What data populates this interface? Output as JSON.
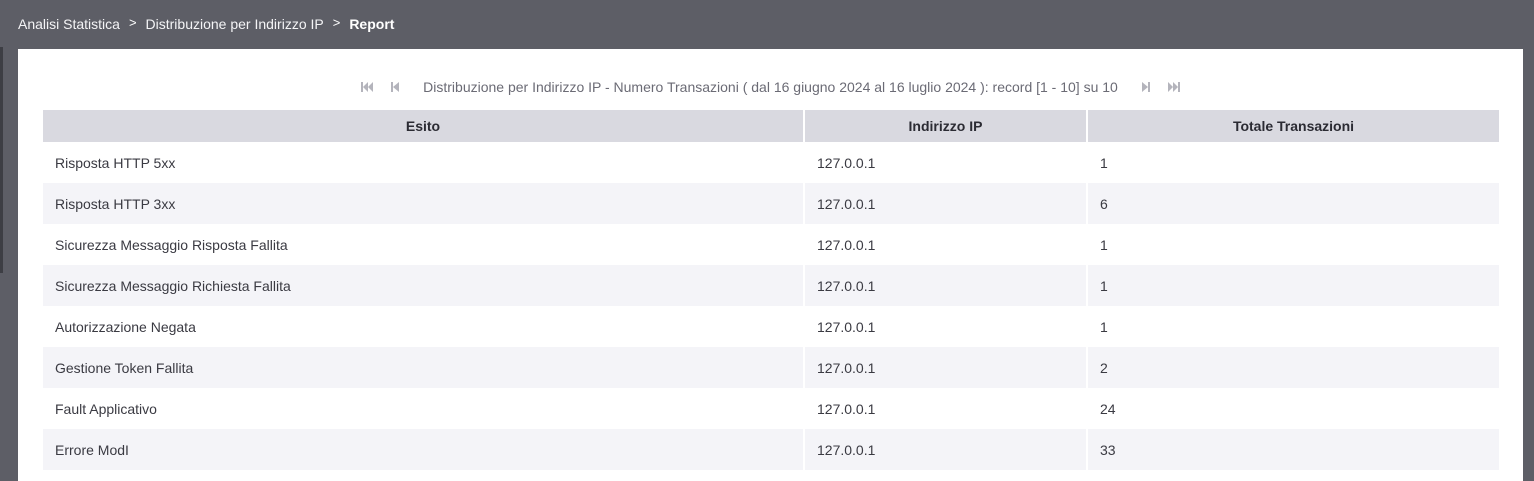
{
  "breadcrumb": {
    "items": [
      {
        "label": "Analisi Statistica"
      },
      {
        "label": "Distribuzione per Indirizzo IP"
      },
      {
        "label": "Report"
      }
    ],
    "separator": ">"
  },
  "pager": {
    "text": "Distribuzione per Indirizzo IP - Numero Transazioni ( dal 16 giugno 2024 al 16 luglio 2024 ): record [1 - 10] su 10",
    "icons": [
      "first-page-icon",
      "previous-page-icon",
      "next-page-icon",
      "last-page-icon"
    ]
  },
  "table": {
    "headers": [
      "Esito",
      "Indirizzo IP",
      "Totale Transazioni"
    ],
    "rows": [
      [
        "Risposta HTTP 5xx",
        "127.0.0.1",
        "1"
      ],
      [
        "Risposta HTTP 3xx",
        "127.0.0.1",
        "6"
      ],
      [
        "Sicurezza Messaggio Risposta Fallita",
        "127.0.0.1",
        "1"
      ],
      [
        "Sicurezza Messaggio Richiesta Fallita",
        "127.0.0.1",
        "1"
      ],
      [
        "Autorizzazione Negata",
        "127.0.0.1",
        "1"
      ],
      [
        "Gestione Token Fallita",
        "127.0.0.1",
        "2"
      ],
      [
        "Fault Applicativo",
        "127.0.0.1",
        "24"
      ],
      [
        "Errore ModI",
        "127.0.0.1",
        "33"
      ]
    ]
  },
  "colors": {
    "topbar": "#5d5e66",
    "header_bg": "#d9d9e0",
    "row_alt": "#f4f4f8"
  }
}
